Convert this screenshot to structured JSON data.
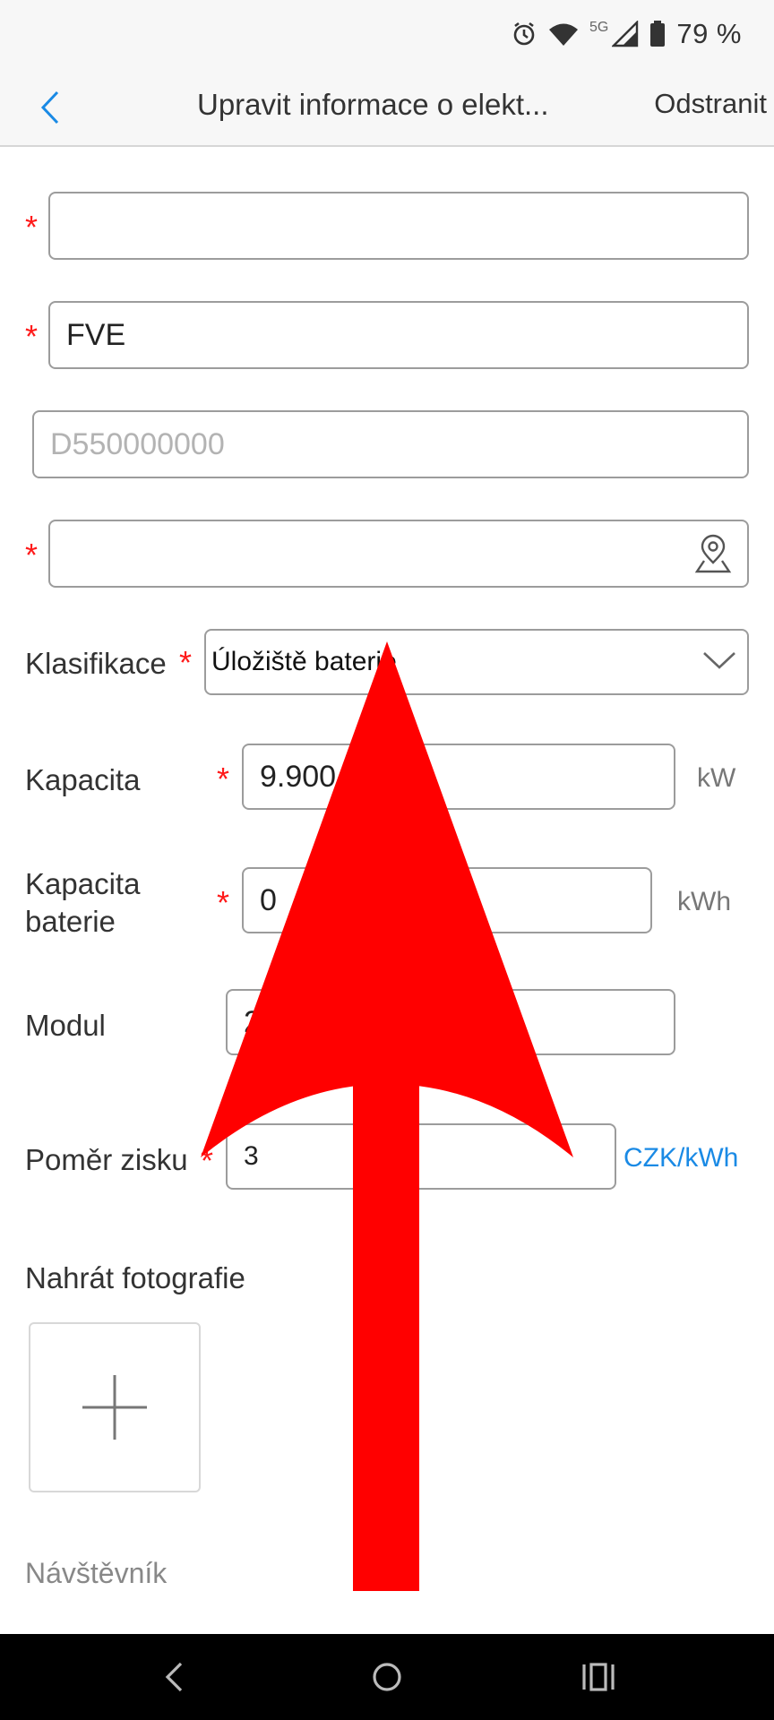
{
  "status_bar": {
    "battery": "79 %",
    "network": "5G",
    "icons": [
      "alarm-icon",
      "wifi-icon",
      "signal-icon",
      "battery-icon"
    ]
  },
  "header": {
    "title": "Upravit informace o elekt...",
    "delete_label": "Odstranit",
    "back_icon": "chevron-left-icon"
  },
  "form": {
    "field1": {
      "value": "",
      "required": true
    },
    "field2": {
      "value": "FVE",
      "required": true
    },
    "field3": {
      "value": "",
      "placeholder": "D550000000",
      "required": false
    },
    "field4": {
      "value": "",
      "required": true,
      "icon": "location-pin-icon"
    },
    "classification": {
      "label": "Klasifikace",
      "value": "Úložiště baterie",
      "required": true
    },
    "capacity": {
      "label": "Kapacita",
      "value": "9.900",
      "unit": "kW",
      "required": true
    },
    "battery_capacity": {
      "label": "Kapacita baterie",
      "value": "0",
      "unit": "kWh",
      "required": true
    },
    "module": {
      "label": "Modul",
      "value": "2"
    },
    "profit_ratio": {
      "label": "Poměr zisku",
      "value": "3",
      "unit": "CZK/kWh",
      "required": true
    },
    "required_mark": "*"
  },
  "upload": {
    "title": "Nahrát fotografie",
    "icon": "plus-icon"
  },
  "visitor": {
    "label": "Návštěvník"
  },
  "colors": {
    "accent": "#1a8ae5",
    "required": "#ff1a1a",
    "overlay_arrow": "#ff0000"
  },
  "nav_bar": {
    "icons": [
      "back-nav-icon",
      "home-nav-icon",
      "recents-nav-icon"
    ]
  }
}
